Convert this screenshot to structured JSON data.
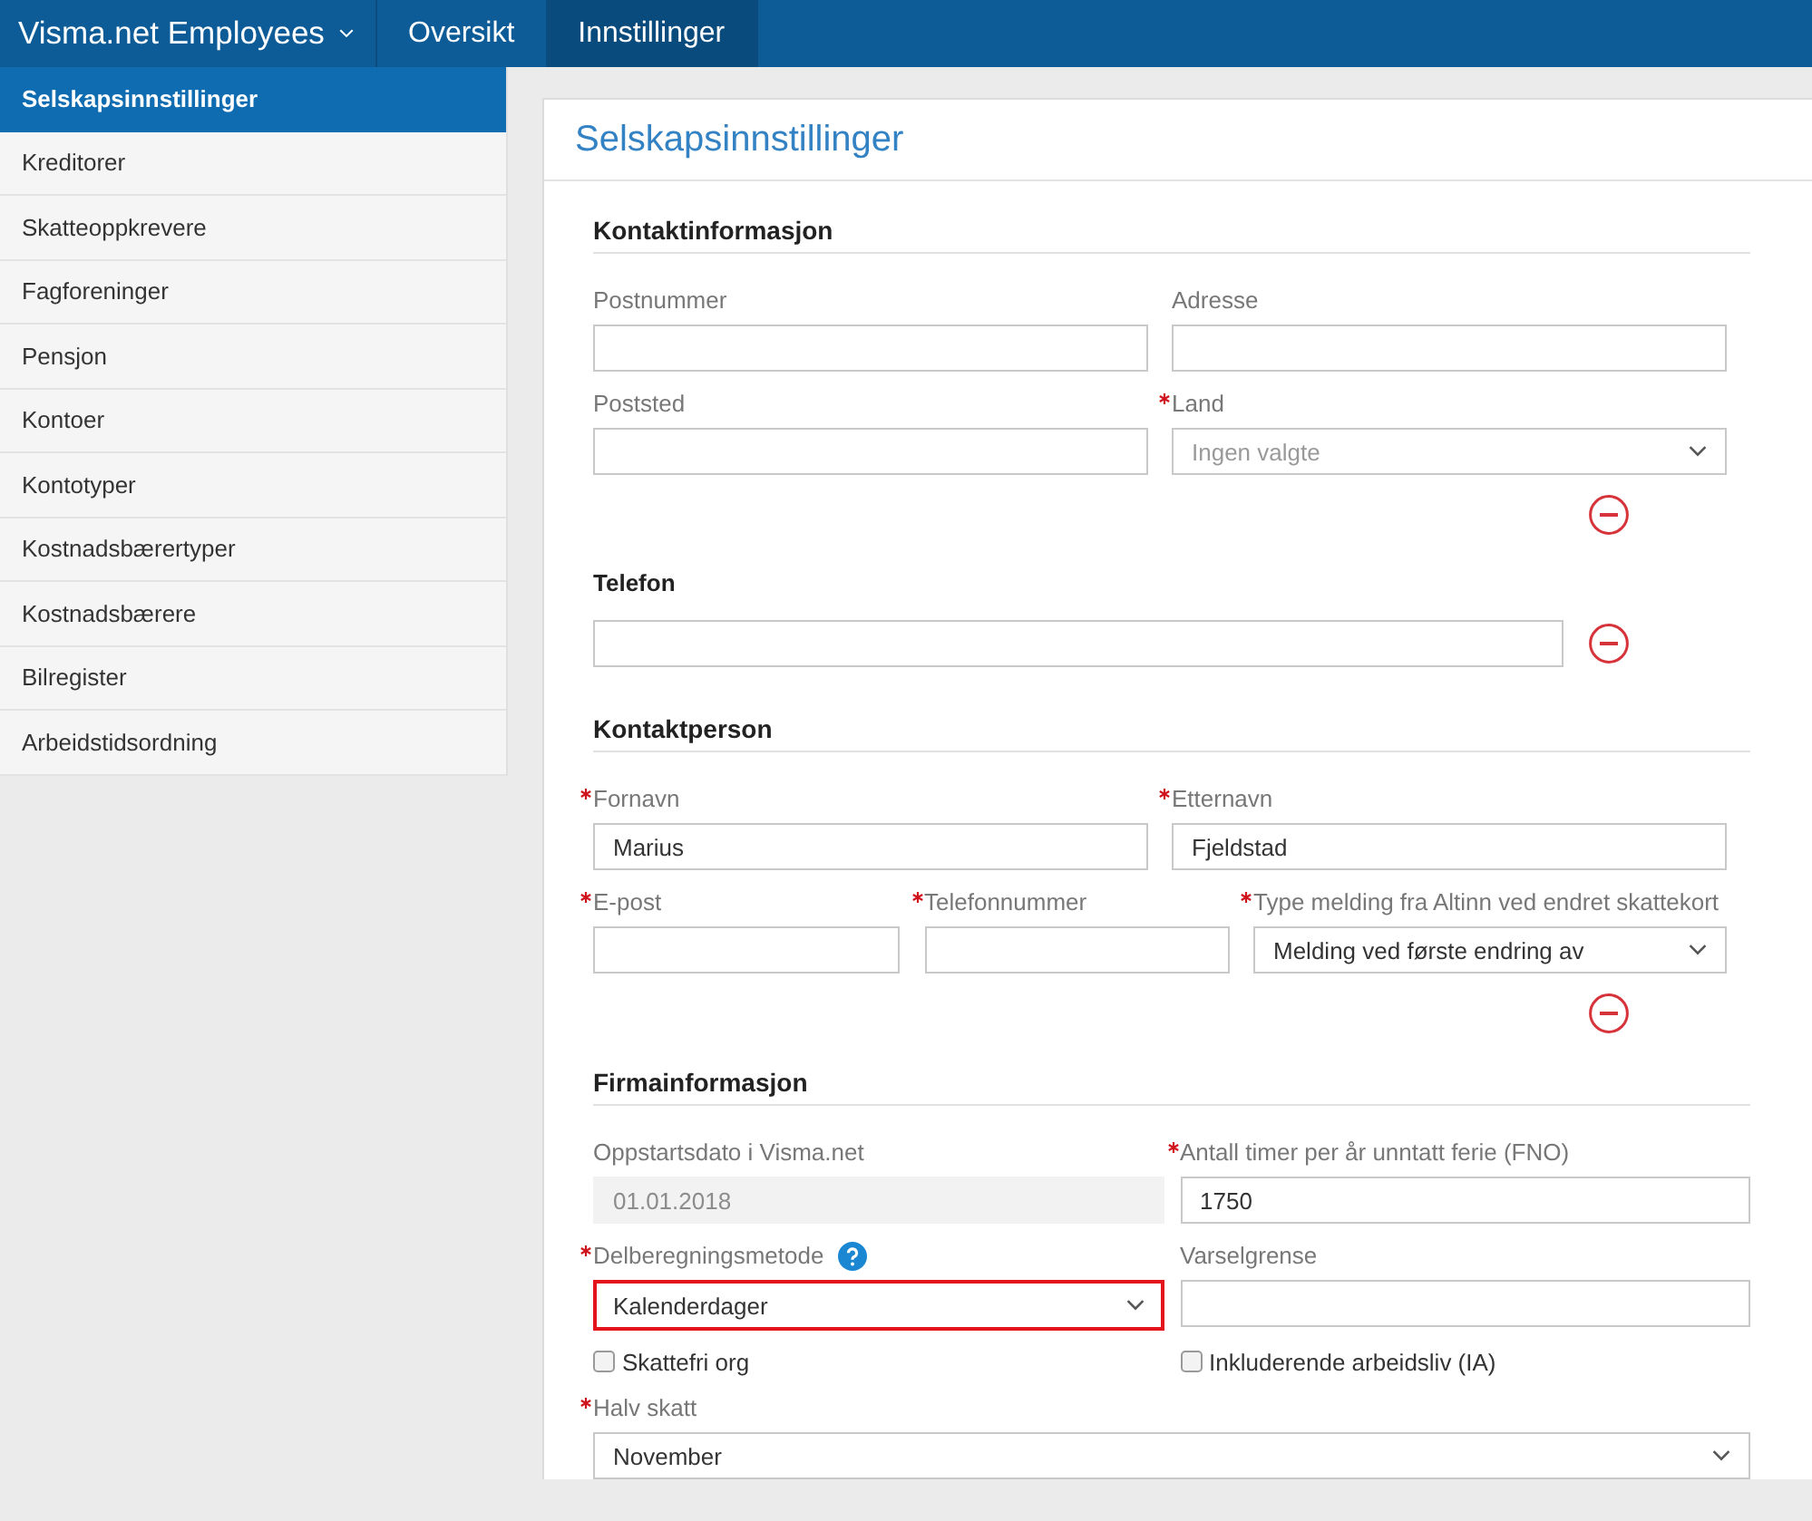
{
  "top_bar": {
    "brand": "Visma.net Employees",
    "tabs": [
      {
        "label": "Oversikt",
        "selected": false
      },
      {
        "label": "Innstillinger",
        "selected": true
      }
    ]
  },
  "sidebar": {
    "items": [
      {
        "label": "Selskapsinnstillinger",
        "selected": true
      },
      {
        "label": "Kreditorer",
        "selected": false
      },
      {
        "label": "Skatteoppkrevere",
        "selected": false
      },
      {
        "label": "Fagforeninger",
        "selected": false
      },
      {
        "label": "Pensjon",
        "selected": false
      },
      {
        "label": "Kontoer",
        "selected": false
      },
      {
        "label": "Kontotyper",
        "selected": false
      },
      {
        "label": "Kostnadsbærertyper",
        "selected": false
      },
      {
        "label": "Kostnadsbærere",
        "selected": false
      },
      {
        "label": "Bilregister",
        "selected": false
      },
      {
        "label": "Arbeidstidsordning",
        "selected": false
      }
    ]
  },
  "page": {
    "title": "Selskapsinnstillinger",
    "sections": [
      {
        "heading": "Kontaktinformasjon",
        "kind": "contact",
        "rows": [
          {
            "kind": "fields",
            "fields": [
              {
                "kind": "input",
                "label": "Postnummer",
                "required": false
              },
              {
                "kind": "input",
                "label": "Adresse",
                "required": false
              }
            ]
          },
          {
            "kind": "fields",
            "fields": [
              {
                "kind": "input",
                "label": "Poststed",
                "required": false
              },
              {
                "kind": "select",
                "label": "Land",
                "required": true,
                "placeholder": "Ingen valgte"
              }
            ]
          },
          {
            "kind": "remove"
          }
        ]
      },
      {
        "heading": "Telefon",
        "kind": "phone",
        "rows": [
          {
            "kind": "field-remove",
            "fields": [
              {
                "kind": "input"
              }
            ]
          }
        ]
      },
      {
        "heading": "Kontaktperson",
        "kind": "contact",
        "rows": [
          {
            "kind": "fields",
            "fields": [
              {
                "kind": "input",
                "label": "Fornavn",
                "required": true,
                "value": "Marius"
              },
              {
                "kind": "input",
                "label": "Etternavn",
                "required": true,
                "value": "Fjeldstad"
              }
            ]
          },
          {
            "kind": "fields",
            "fields": [
              {
                "kind": "input",
                "label": "E-post",
                "required": true
              },
              {
                "kind": "input",
                "label": "Telefonnummer",
                "required": true
              },
              {
                "kind": "select",
                "label": "Type melding fra Altinn ved endret skattekort",
                "required": true,
                "value": "Melding ved første endring av"
              }
            ]
          },
          {
            "kind": "remove"
          }
        ]
      },
      {
        "heading": "Firmainformasjon",
        "kind": "company",
        "rows": [
          {
            "kind": "fields",
            "fields": [
              {
                "kind": "input",
                "label": "Oppstartsdato i Visma.net",
                "required": false,
                "disabled": true,
                "value": "01.01.2018"
              },
              {
                "kind": "input",
                "label": "Antall timer per år unntatt ferie (FNO)",
                "required": true,
                "disabled": false,
                "value": "1750"
              }
            ]
          },
          {
            "kind": "fields",
            "fields": [
              {
                "kind": "select",
                "label": "Delberegningsmetode",
                "required": true,
                "help": true,
                "highlighted": true,
                "value": "Kalenderdager"
              },
              {
                "kind": "input",
                "label": "Varselgrense",
                "required": false,
                "help": false,
                "highlighted": false
              }
            ]
          },
          {
            "kind": "fields",
            "fields": [
              {
                "kind": "checkbox",
                "label": "Skattefri org",
                "checked": false
              },
              {
                "kind": "checkbox",
                "label": "Inkluderende arbeidsliv (IA)",
                "checked": false
              }
            ]
          },
          {
            "kind": "fields",
            "fields": [
              {
                "kind": "select",
                "label": "Halv skatt",
                "required": true,
                "value": "November"
              }
            ]
          }
        ]
      }
    ]
  }
}
